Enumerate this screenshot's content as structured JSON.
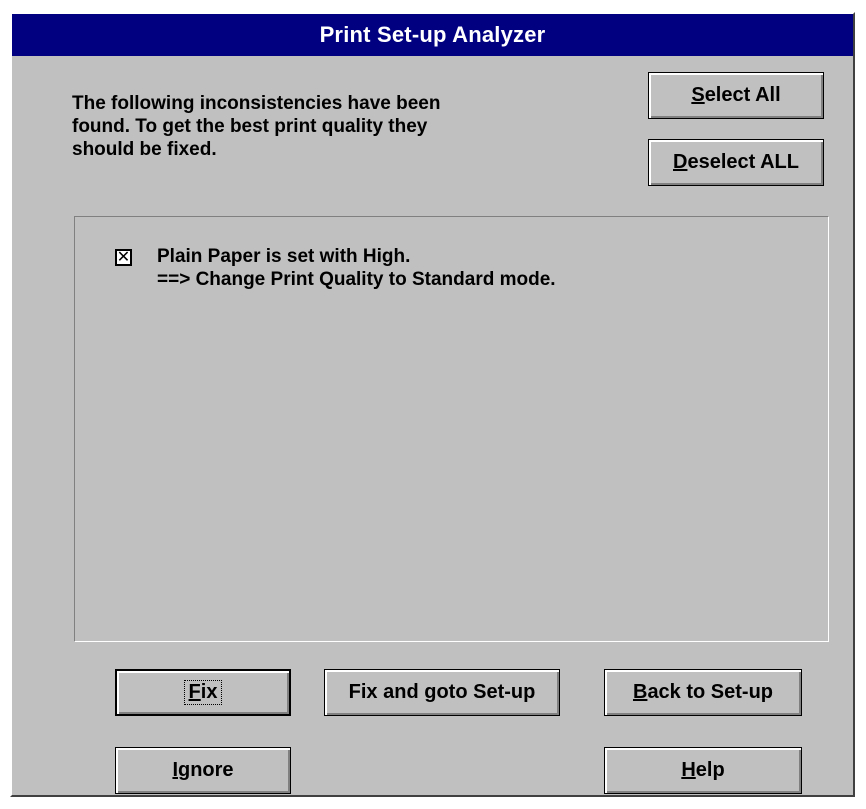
{
  "window": {
    "title": "Print Set-up Analyzer"
  },
  "intro": {
    "text": "The following inconsistencies have been\nfound. To get the best print quality they\nshould be fixed."
  },
  "buttons": {
    "select_all": {
      "mnemonic": "S",
      "rest": "elect All"
    },
    "deselect_all": {
      "mnemonic": "D",
      "rest": "eselect ALL"
    },
    "fix": {
      "mnemonic": "F",
      "rest": "ix"
    },
    "fix_goto": {
      "before": "Fix and ",
      "mnemonic": "g",
      "rest": "oto Set-up"
    },
    "back": {
      "mnemonic": "B",
      "rest": "ack to Set-up"
    },
    "ignore": {
      "mnemonic": "I",
      "rest": "gnore"
    },
    "help": {
      "mnemonic": "H",
      "rest": "elp"
    }
  },
  "items": [
    {
      "checked": true,
      "check_glyph": "✕",
      "line1": "Plain Paper is set with High.",
      "line2": "==> Change Print Quality to Standard mode."
    }
  ]
}
